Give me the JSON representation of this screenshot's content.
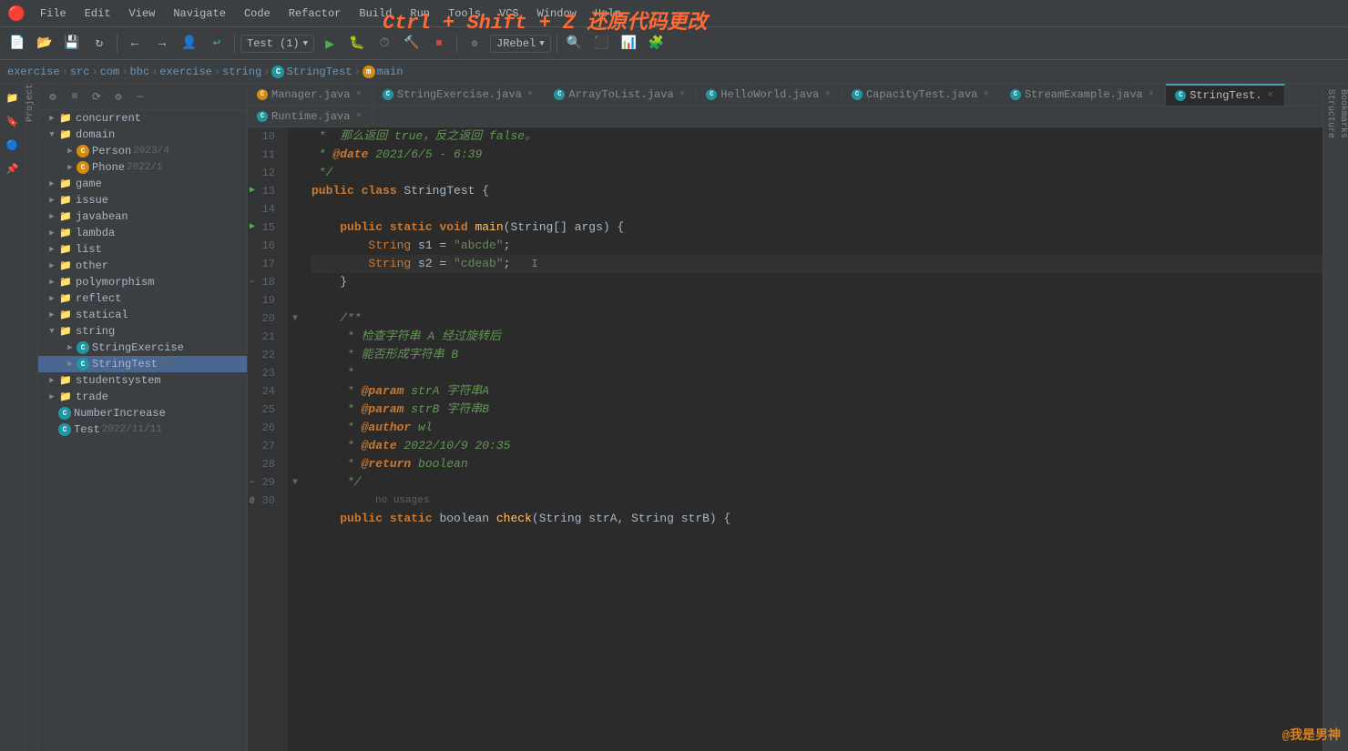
{
  "app": {
    "title": "IntelliJ IDEA"
  },
  "overlay": {
    "undo_hint": "Ctrl + Shift + Z  还原代码更改"
  },
  "menu": {
    "logo": "🔴",
    "items": [
      "File",
      "Edit",
      "View",
      "Navigate",
      "Code",
      "Refactor",
      "Build",
      "Run",
      "Tools",
      "VCS",
      "Window",
      "Help"
    ]
  },
  "toolbar": {
    "run_config": "Test (1)",
    "jrebel": "JRebel"
  },
  "breadcrumb": {
    "items": [
      "exercise",
      "src",
      "com",
      "bbc",
      "exercise",
      "string",
      "StringTest",
      "main"
    ]
  },
  "file_tree": {
    "title": "Project",
    "items": [
      {
        "type": "folder",
        "name": "concurrent",
        "level": 1,
        "expanded": false
      },
      {
        "type": "folder",
        "name": "domain",
        "level": 1,
        "expanded": true
      },
      {
        "type": "class_c",
        "name": "Person",
        "level": 2,
        "date": "2023/4",
        "icon": "orange"
      },
      {
        "type": "class_c",
        "name": "Phone",
        "level": 2,
        "date": "2022/1",
        "icon": "orange"
      },
      {
        "type": "folder",
        "name": "game",
        "level": 1,
        "expanded": false
      },
      {
        "type": "folder",
        "name": "issue",
        "level": 1,
        "expanded": false
      },
      {
        "type": "folder",
        "name": "javabean",
        "level": 1,
        "expanded": false
      },
      {
        "type": "folder",
        "name": "lambda",
        "level": 1,
        "expanded": false
      },
      {
        "type": "folder",
        "name": "list",
        "level": 1,
        "expanded": false
      },
      {
        "type": "folder",
        "name": "other",
        "level": 1,
        "expanded": false
      },
      {
        "type": "folder",
        "name": "polymorphism",
        "level": 1,
        "expanded": false
      },
      {
        "type": "folder",
        "name": "reflect",
        "level": 1,
        "expanded": false
      },
      {
        "type": "folder",
        "name": "statical",
        "level": 1,
        "expanded": false
      },
      {
        "type": "folder",
        "name": "string",
        "level": 1,
        "expanded": true
      },
      {
        "type": "class_c",
        "name": "StringExercise",
        "level": 2,
        "date": "",
        "icon": "teal"
      },
      {
        "type": "class_c",
        "name": "StringTest",
        "level": 2,
        "date": "20",
        "icon": "teal",
        "selected": true
      },
      {
        "type": "folder",
        "name": "studentsystem",
        "level": 1,
        "expanded": false
      },
      {
        "type": "folder",
        "name": "trade",
        "level": 1,
        "expanded": false
      },
      {
        "type": "class_c",
        "name": "NumberIncrease",
        "level": 1,
        "date": "",
        "icon": "teal"
      },
      {
        "type": "class_c",
        "name": "Test",
        "level": 1,
        "date": "2022/11/11",
        "icon": "teal"
      }
    ]
  },
  "tabs": {
    "row1": [
      {
        "name": "Manager.java",
        "icon": "orange",
        "active": false
      },
      {
        "name": "StringExercise.java",
        "icon": "teal",
        "active": false
      },
      {
        "name": "ArrayToList.java",
        "icon": "teal",
        "active": false
      },
      {
        "name": "HelloWorld.java",
        "icon": "teal",
        "active": false
      },
      {
        "name": "CapacityTest.java",
        "icon": "teal",
        "active": false
      },
      {
        "name": "StreamExample.java",
        "icon": "teal",
        "active": false
      },
      {
        "name": "StringTest.",
        "icon": "teal",
        "active": true
      }
    ],
    "row2": [
      {
        "name": "Runtime.java",
        "icon": "teal",
        "active": false
      }
    ]
  },
  "code": {
    "lines": [
      {
        "num": 10,
        "content": " *  那么返回 true，反之返回 false。",
        "type": "comment"
      },
      {
        "num": 11,
        "content": " * @date 2021/6/5 - 6:39",
        "type": "comment"
      },
      {
        "num": 12,
        "content": " */",
        "type": "comment"
      },
      {
        "num": 13,
        "content": "public class StringTest {",
        "type": "class_def",
        "has_run": true
      },
      {
        "num": 14,
        "content": "",
        "type": "empty"
      },
      {
        "num": 15,
        "content": "    public static void main(String[] args) {",
        "type": "method_def",
        "has_run": true
      },
      {
        "num": 16,
        "content": "        String s1 = \"abcde\";",
        "type": "code"
      },
      {
        "num": 17,
        "content": "        String s2 = \"cdeab\";",
        "type": "code",
        "cursor": true
      },
      {
        "num": 18,
        "content": "    }",
        "type": "code"
      },
      {
        "num": 19,
        "content": "",
        "type": "empty"
      },
      {
        "num": 20,
        "content": "    /**",
        "type": "comment",
        "fold": true
      },
      {
        "num": 21,
        "content": "     * 检查字符串 A 经过旋转后",
        "type": "comment"
      },
      {
        "num": 22,
        "content": "     * 能否形成字符串 B",
        "type": "comment"
      },
      {
        "num": 23,
        "content": "     *",
        "type": "comment"
      },
      {
        "num": 24,
        "content": "     * @param strA 字符串A",
        "type": "comment"
      },
      {
        "num": 25,
        "content": "     * @param strB 字符串B",
        "type": "comment"
      },
      {
        "num": 26,
        "content": "     * @author wl",
        "type": "comment"
      },
      {
        "num": 27,
        "content": "     * @date 2022/10/9 20:35",
        "type": "comment"
      },
      {
        "num": 28,
        "content": "     * @return boolean",
        "type": "comment"
      },
      {
        "num": 29,
        "content": "     */",
        "type": "comment",
        "fold": true
      },
      {
        "num": 30,
        "content": "    public static boolean check(String strA, String strB) {",
        "type": "method_def"
      }
    ]
  }
}
